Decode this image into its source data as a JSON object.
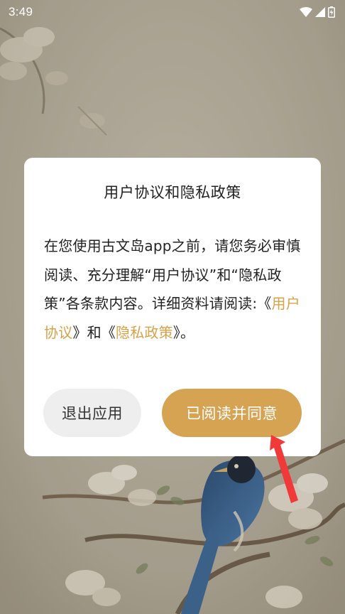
{
  "status_bar": {
    "time": "3:49",
    "icons": [
      "wifi-icon",
      "signal-icon",
      "battery-icon"
    ]
  },
  "background": {
    "description_icon": "bird-on-magnolia-painting"
  },
  "dialog": {
    "title": "用户协议和隐私政策",
    "body_prefix": "在您使用古文岛app之前，请您务必审慎阅读、充分理解“用户协议”和“隐私政策”各条款内容。详细资料请阅读:《",
    "link_user_agreement": "用户协议",
    "body_middle": "》和《",
    "link_privacy_policy": "隐私政策",
    "body_suffix": "》。",
    "exit_button": "退出应用",
    "agree_button": "已阅读并同意"
  },
  "colors": {
    "accent": "#d5a352",
    "link": "#d7a248",
    "arrow": "#f03a3a"
  }
}
